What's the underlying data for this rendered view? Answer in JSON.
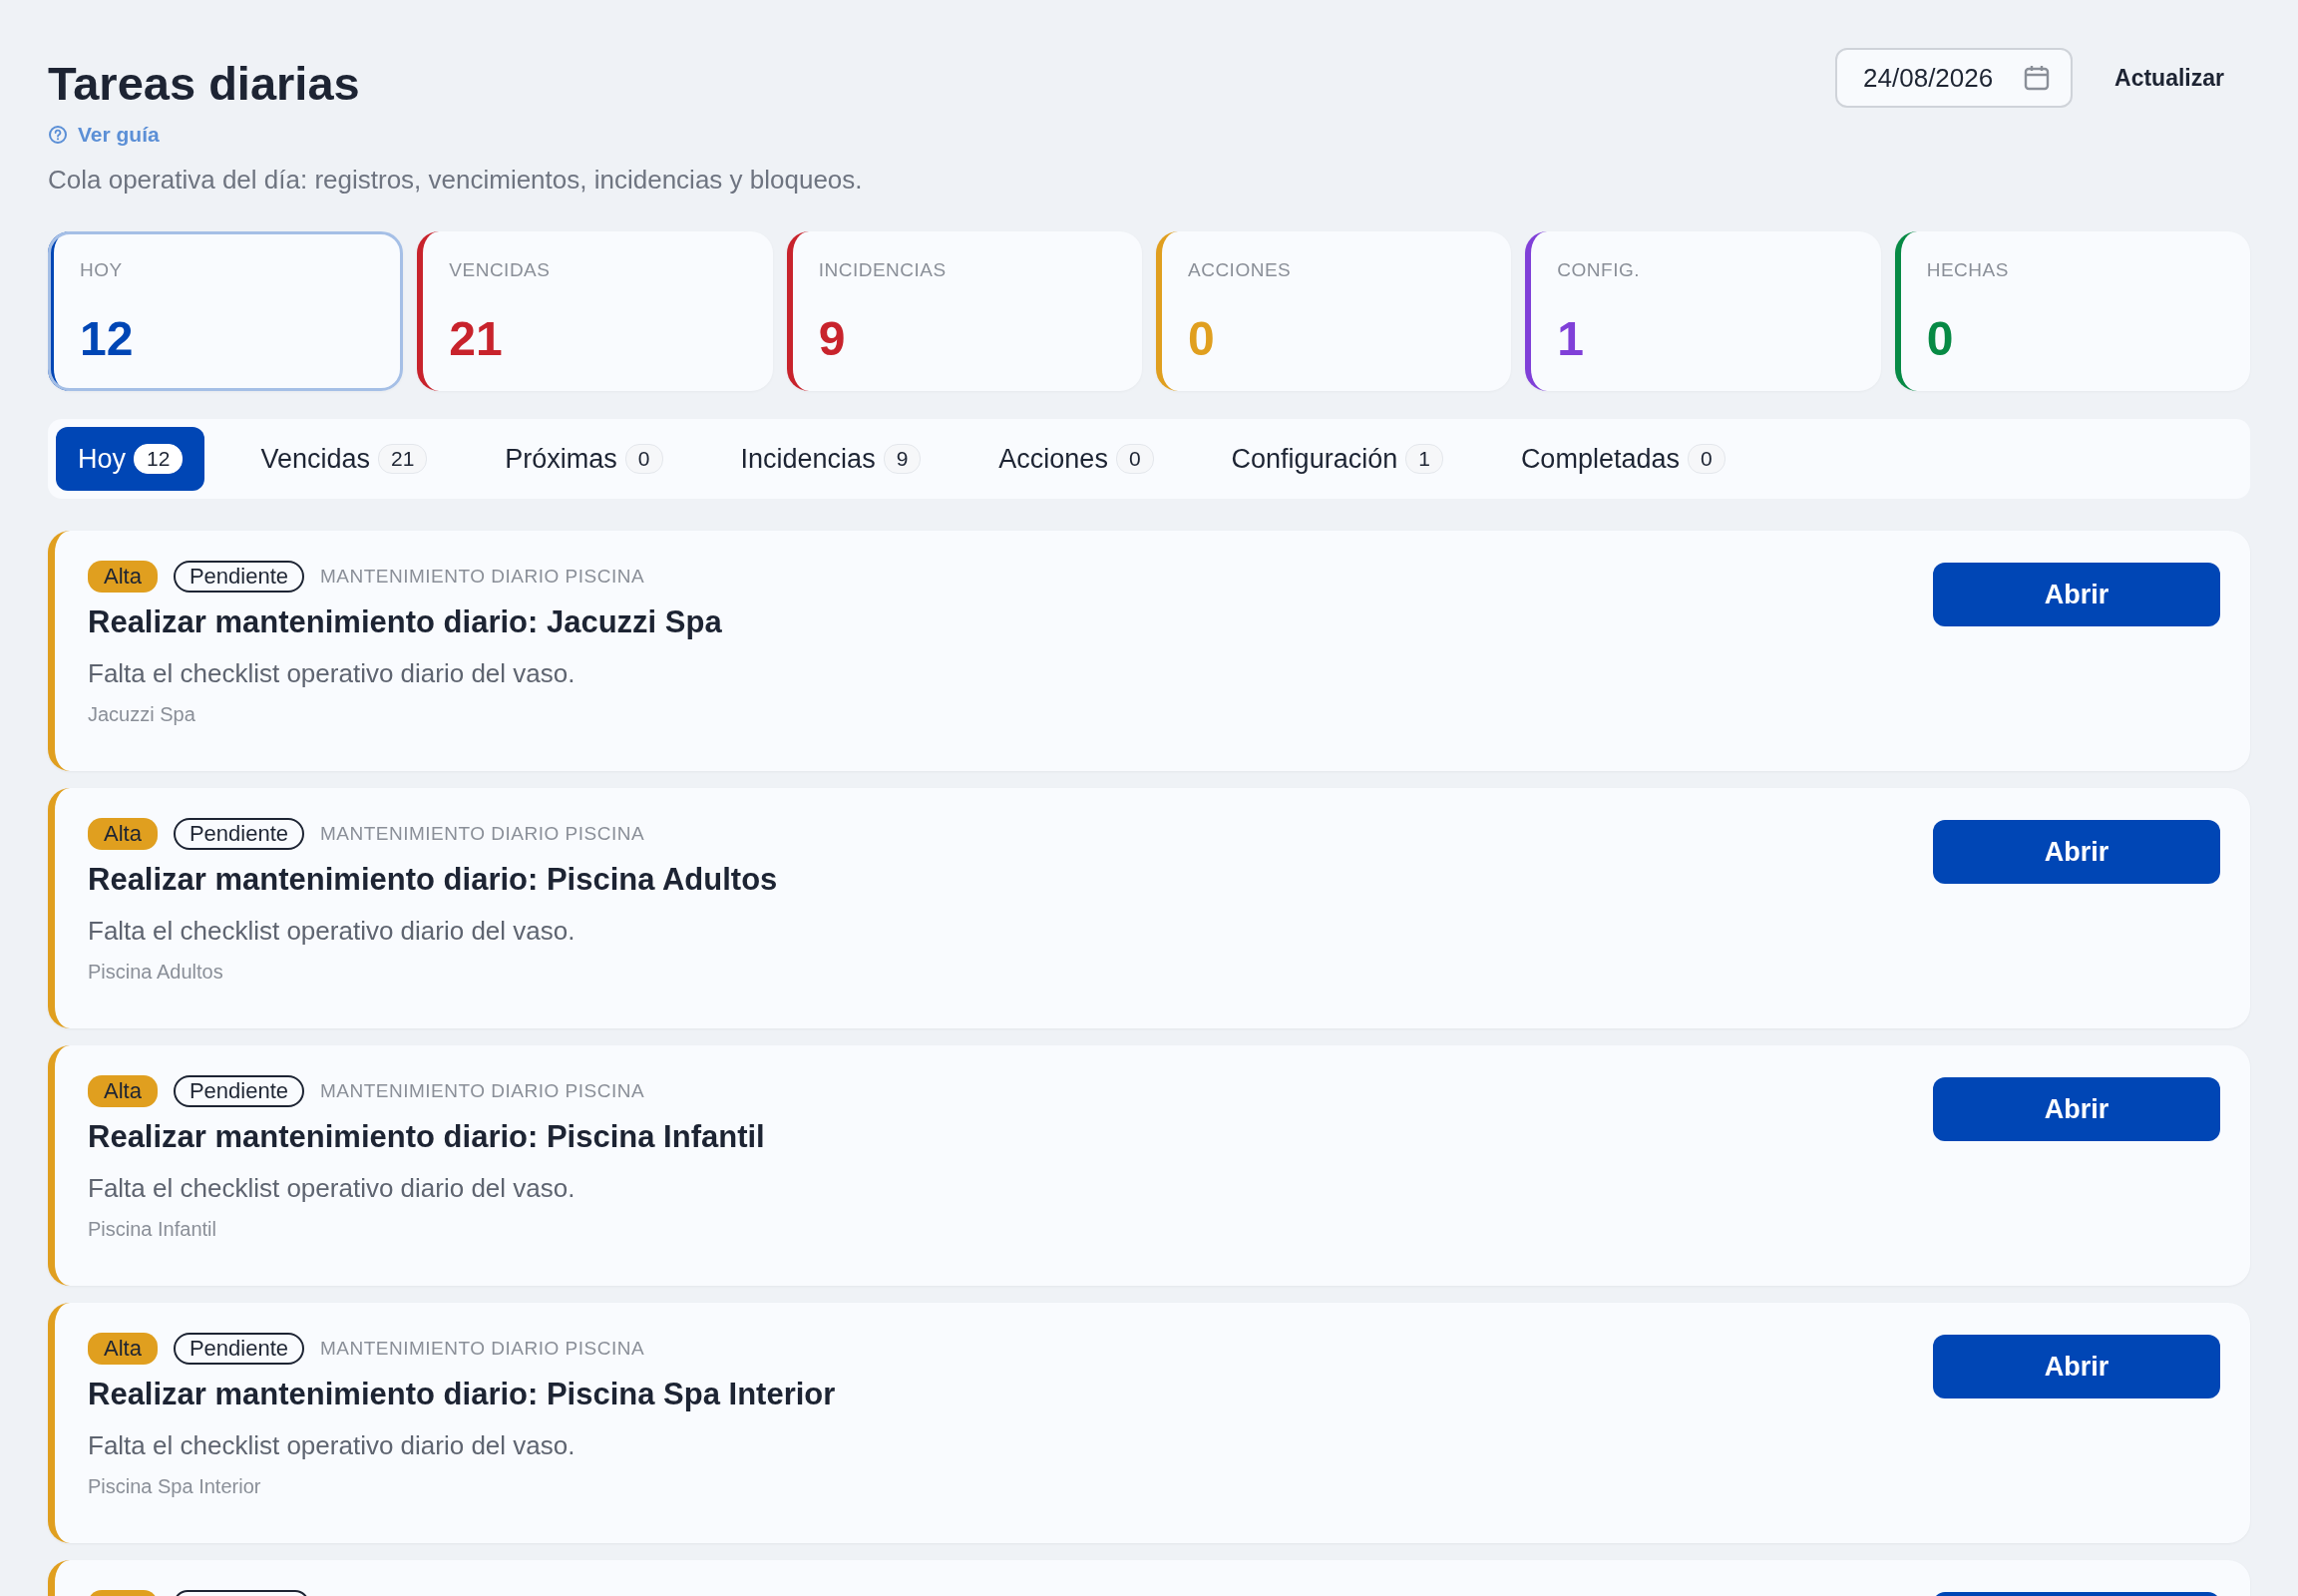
{
  "header": {
    "title": "Tareas diarias",
    "guide_link": "Ver guía",
    "subtitle": "Cola operativa del día: registros, vencimientos, incidencias y bloqueos.",
    "date_value": "24/08/2026",
    "refresh_button": "Actualizar"
  },
  "kpis": [
    {
      "label": "HOY",
      "value": "12",
      "color": "#0046b5",
      "selected": true
    },
    {
      "label": "VENCIDAS",
      "value": "21",
      "color": "#c8232c",
      "selected": false
    },
    {
      "label": "INCIDENCIAS",
      "value": "9",
      "color": "#c8232c",
      "selected": false
    },
    {
      "label": "ACCIONES",
      "value": "0",
      "color": "#e09f1f",
      "selected": false
    },
    {
      "label": "CONFIG.",
      "value": "1",
      "color": "#8040d8",
      "selected": false
    },
    {
      "label": "HECHAS",
      "value": "0",
      "color": "#078a45",
      "selected": false
    }
  ],
  "tabs": [
    {
      "label": "Hoy",
      "count": "12",
      "selected": true
    },
    {
      "label": "Vencidas",
      "count": "21",
      "selected": false
    },
    {
      "label": "Próximas",
      "count": "0",
      "selected": false
    },
    {
      "label": "Incidencias",
      "count": "9",
      "selected": false
    },
    {
      "label": "Acciones",
      "count": "0",
      "selected": false
    },
    {
      "label": "Configuración",
      "count": "1",
      "selected": false
    },
    {
      "label": "Completadas",
      "count": "0",
      "selected": false
    }
  ],
  "tasks": [
    {
      "priority": "Alta",
      "status": "Pendiente",
      "category": "MANTENIMIENTO DIARIO PISCINA",
      "title": "Realizar mantenimiento diario: Jacuzzi Spa",
      "description": "Falta el checklist operativo diario del vaso.",
      "location": "Jacuzzi Spa",
      "color": "#e09f1f",
      "action": "Abrir"
    },
    {
      "priority": "Alta",
      "status": "Pendiente",
      "category": "MANTENIMIENTO DIARIO PISCINA",
      "title": "Realizar mantenimiento diario: Piscina Adultos",
      "description": "Falta el checklist operativo diario del vaso.",
      "location": "Piscina Adultos",
      "color": "#e09f1f",
      "action": "Abrir"
    },
    {
      "priority": "Alta",
      "status": "Pendiente",
      "category": "MANTENIMIENTO DIARIO PISCINA",
      "title": "Realizar mantenimiento diario: Piscina Infantil",
      "description": "Falta el checklist operativo diario del vaso.",
      "location": "Piscina Infantil",
      "color": "#e09f1f",
      "action": "Abrir"
    },
    {
      "priority": "Alta",
      "status": "Pendiente",
      "category": "MANTENIMIENTO DIARIO PISCINA",
      "title": "Realizar mantenimiento diario: Piscina Spa Interior",
      "description": "Falta el checklist operativo diario del vaso.",
      "location": "Piscina Spa Interior",
      "color": "#e09f1f",
      "action": "Abrir"
    }
  ],
  "more_below": true
}
